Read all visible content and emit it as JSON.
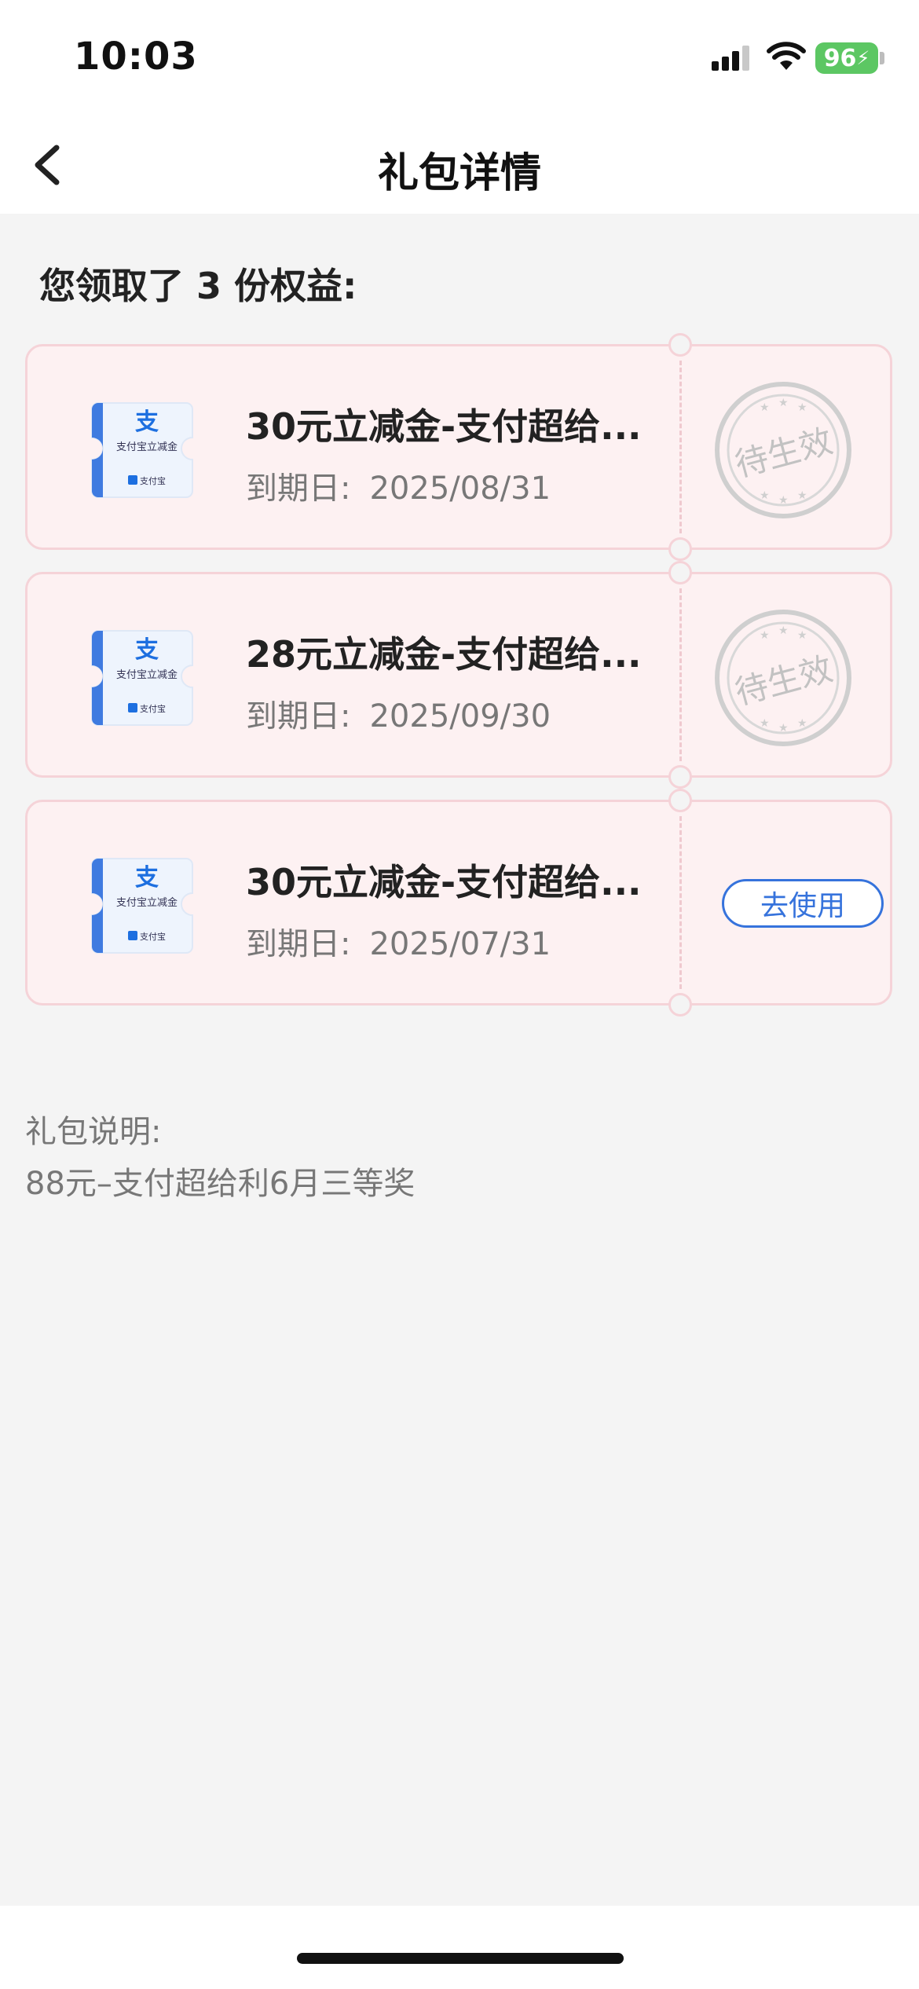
{
  "status_bar": {
    "time": "10:03",
    "battery": "96"
  },
  "nav": {
    "title": "礼包详情"
  },
  "summary": "您领取了 3 份权益:",
  "coupons": [
    {
      "title": "30元立减金-支付超给...",
      "expire_label": "到期日:",
      "expire_date": "2025/08/31",
      "status": "待生效",
      "card_text": "支付宝立减金",
      "brand": "支付宝"
    },
    {
      "title": "28元立减金-支付超给...",
      "expire_label": "到期日:",
      "expire_date": "2025/09/30",
      "status": "待生效",
      "card_text": "支付宝立减金",
      "brand": "支付宝"
    },
    {
      "title": "30元立减金-支付超给...",
      "expire_label": "到期日:",
      "expire_date": "2025/07/31",
      "action": "去使用",
      "card_text": "支付宝立减金",
      "brand": "支付宝"
    }
  ],
  "description": {
    "label": "礼包说明:",
    "text": "88元–支付超给利6月三等奖"
  },
  "colors": {
    "accent_blue": "#3673dc",
    "coupon_bg": "#fdf1f2",
    "coupon_border": "#f5d3d8",
    "battery_green": "#5cc763"
  }
}
